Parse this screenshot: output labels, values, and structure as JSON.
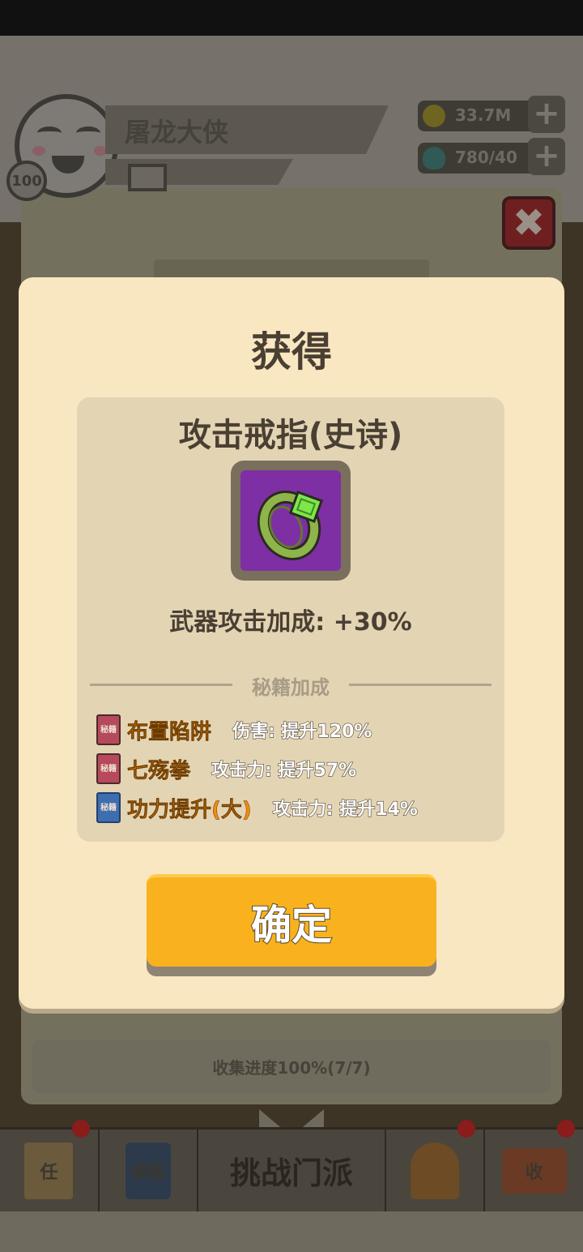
{
  "player": {
    "name": "屠龙大侠",
    "level": "100"
  },
  "resources": {
    "gold": "33.7M",
    "gems": "780/40"
  },
  "background": {
    "collection_progress": "收集进度100%(7/7)"
  },
  "bottom_nav": {
    "task_glyph": "任",
    "cultivate_glyph": "修炼",
    "challenge_label": "挑战门派",
    "shop_glyph": "收"
  },
  "modal": {
    "title": "获得",
    "item": {
      "name": "攻击戒指(史诗)",
      "icon": "ring-icon",
      "frame_color": "#7e2fa3",
      "stat": "武器攻击加成: +30%"
    },
    "bonus_header": "秘籍加成",
    "bonuses": [
      {
        "book_color": "red",
        "book_glyph": "秘籍",
        "skill": "布置陷阱",
        "effect": "伤害: 提升120%"
      },
      {
        "book_color": "red",
        "book_glyph": "秘籍",
        "skill": "七殇拳",
        "effect": "攻击力: 提升57%"
      },
      {
        "book_color": "blue",
        "book_glyph": "秘籍",
        "skill": "功力提升(大)",
        "effect": "攻击力: 提升14%"
      }
    ],
    "confirm_label": "确定"
  },
  "colors": {
    "modal_bg": "#f9e7c1",
    "card_bg": "#e3d4b3",
    "confirm_button": "#f9b21d",
    "skill_name": "#f08c10"
  }
}
